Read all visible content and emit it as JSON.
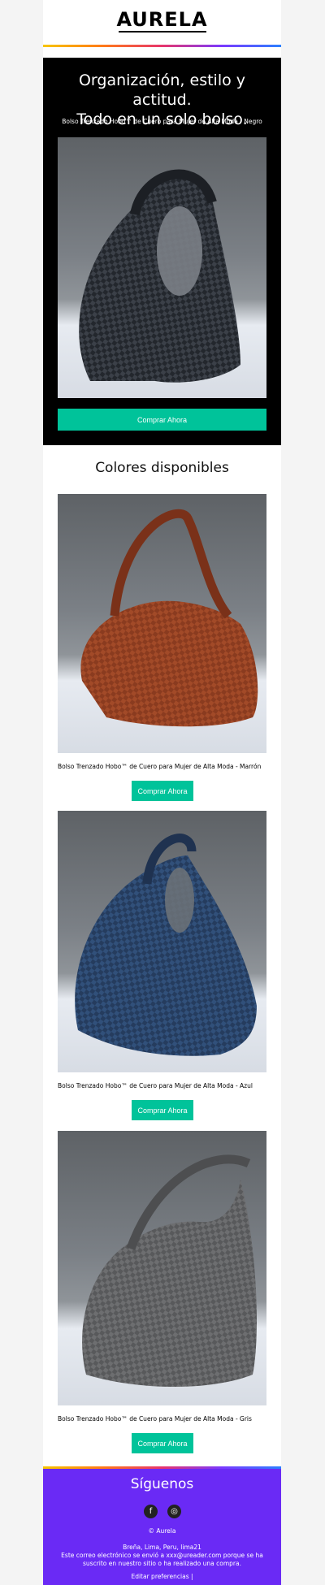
{
  "header": {
    "logo": "AURELA"
  },
  "hero": {
    "title_line1": "Organización, estilo y actitud.",
    "title_line2": "Todo en un solo bolso.",
    "subtitle": "Bolso Trenzado Hobo™ de Cuero para Mujer de Alta Moda - Negro",
    "cta": "Comprar Ahora",
    "bag_color": "#23272d"
  },
  "colors_section": {
    "title": "Colores disponibles",
    "products": [
      {
        "name": "Bolso Trenzado Hobo™ de Cuero para Mujer de Alta Moda - Marrón",
        "cta": "Comprar Ahora",
        "bag_color": "#8a3b1f"
      },
      {
        "name": "Bolso Trenzado Hobo™ de Cuero para Mujer de Alta Moda - Azul",
        "cta": "Comprar Ahora",
        "bag_color": "#253c5e"
      },
      {
        "name": "Bolso Trenzado Hobo™ de Cuero para Mujer de Alta Moda - Gris",
        "cta": "Comprar Ahora",
        "bag_color": "#58595b"
      }
    ]
  },
  "footer": {
    "title": "Síguenos",
    "social": [
      {
        "icon": "facebook-icon",
        "glyph": "f"
      },
      {
        "icon": "instagram-icon",
        "glyph": "◎"
      }
    ],
    "copyright": "© Aurela",
    "address": "Breña, Lima, Peru, lima21",
    "notice": "Este correo electrónico se envió a xxx@ureader.com porque se ha suscrito en nuestro sitio o ha realizado una compra.",
    "preferences": "Editar preferencias |"
  },
  "theme": {
    "accent": "#00c39a",
    "footer_bg": "#6a2af5",
    "hero_bg": "#000000"
  }
}
